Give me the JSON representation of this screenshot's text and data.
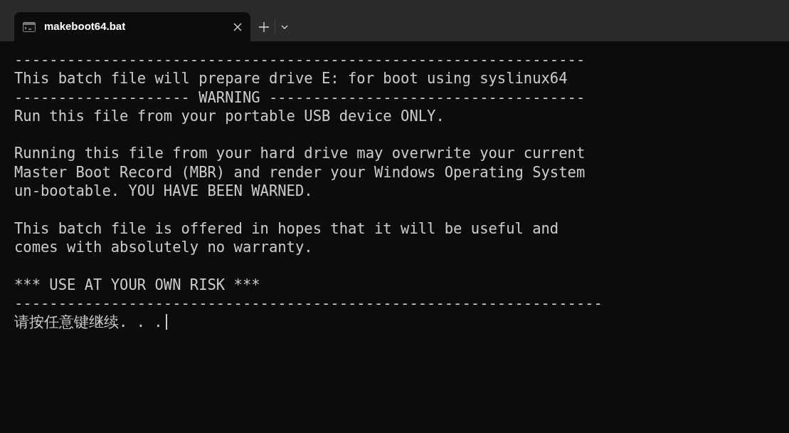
{
  "tabs": [
    {
      "title": "makeboot64.bat",
      "selected": true
    }
  ],
  "output": [
    {
      "lines": [
        "-----------------------------------------------------------------",
        "This batch file will prepare drive E: for boot using syslinux64",
        "-------------------- WARNING ------------------------------------",
        "Run this file from your portable USB device ONLY."
      ]
    },
    {
      "lines": [
        "Running this file from your hard drive may overwrite your current",
        "Master Boot Record (MBR) and render your Windows Operating System",
        "un-bootable. YOU HAVE BEEN WARNED."
      ]
    },
    {
      "lines": [
        "This batch file is offered in hopes that it will be useful and",
        "comes with absolutely no warranty."
      ]
    },
    {
      "lines": [
        "*** USE AT YOUR OWN RISK ***",
        "-------------------------------------------------------------------"
      ]
    }
  ],
  "prompt": "请按任意键继续. . ."
}
